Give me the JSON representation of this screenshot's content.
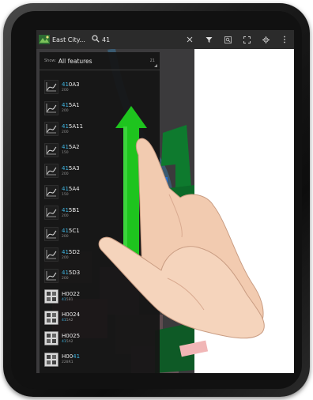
{
  "action_bar": {
    "title": "East City...",
    "search_query": "41",
    "icons": [
      "app-logo-icon",
      "search-icon",
      "close-icon",
      "filter-icon",
      "zoom-to-icon",
      "fullscreen-icon",
      "location-icon",
      "overflow-menu-icon"
    ]
  },
  "filter": {
    "label": "Show:",
    "value": "All features",
    "count": "21"
  },
  "results": [
    {
      "highlight": "41",
      "rest": "0A3",
      "sub": "200",
      "icon": "line-feature-icon"
    },
    {
      "highlight": "41",
      "rest": "5A1",
      "sub": "200",
      "icon": "line-feature-icon"
    },
    {
      "highlight": "41",
      "rest": "5A11",
      "sub": "200",
      "icon": "line-feature-icon"
    },
    {
      "highlight": "41",
      "rest": "5A2",
      "sub": "150",
      "icon": "line-feature-icon"
    },
    {
      "highlight": "41",
      "rest": "5A3",
      "sub": "200",
      "icon": "line-feature-icon"
    },
    {
      "highlight": "41",
      "rest": "5A4",
      "sub": "150",
      "icon": "line-feature-icon"
    },
    {
      "highlight": "41",
      "rest": "5B1",
      "sub": "200",
      "icon": "line-feature-icon"
    },
    {
      "highlight": "41",
      "rest": "5C1",
      "sub": "200",
      "icon": "line-feature-icon"
    },
    {
      "highlight": "41",
      "rest": "5D2",
      "sub": "200",
      "icon": "line-feature-icon"
    },
    {
      "highlight": "41",
      "rest": "5D3",
      "sub": "200",
      "icon": "line-feature-icon"
    },
    {
      "prefix": "H0022",
      "sub_highlight": "41",
      "sub_rest": "5B1",
      "icon": "point-feature-icon"
    },
    {
      "prefix": "H0024",
      "sub_highlight": "41",
      "sub_rest": "5A2",
      "icon": "point-feature-icon"
    },
    {
      "prefix": "H0025",
      "sub_highlight": "41",
      "sub_rest": "5A2",
      "icon": "point-feature-icon"
    },
    {
      "prefix": "H00",
      "highlight": "41",
      "sub": "228R1",
      "icon": "point-feature-icon"
    }
  ],
  "colors": {
    "action_bar": "#2b2b2b",
    "panel": "#141414",
    "highlight": "#3fb4e0",
    "gesture_arrow": "#1ec41e",
    "map_green": "#0e7a2e"
  },
  "gesture": "swipe-up-hand-icon"
}
